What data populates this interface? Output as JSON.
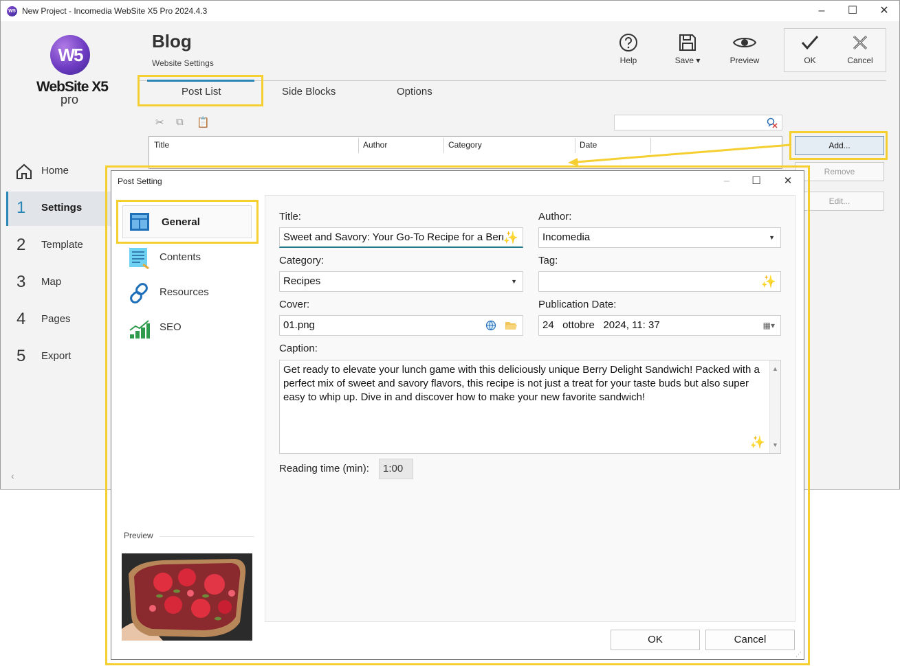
{
  "window": {
    "title": "New Project - Incomedia WebSite X5 Pro 2024.4.3",
    "app_icon": "W5"
  },
  "logo": {
    "mark": "W5",
    "name": "WebSite X5",
    "edition": "pro"
  },
  "header": {
    "title": "Blog",
    "subtitle": "Website Settings"
  },
  "toolbar": {
    "help": "Help",
    "save": "Save ▾",
    "preview": "Preview",
    "ok": "OK",
    "cancel": "Cancel"
  },
  "tabs": [
    {
      "label": "Post List",
      "active": true
    },
    {
      "label": "Side Blocks"
    },
    {
      "label": "Options"
    }
  ],
  "post_table": {
    "columns": [
      "Title",
      "Author",
      "Category",
      "Date"
    ]
  },
  "side_buttons": {
    "add": "Add...",
    "remove": "Remove",
    "edit": "Edit..."
  },
  "nav": [
    {
      "num": "",
      "label": "Home",
      "icon": "home-icon"
    },
    {
      "num": "1",
      "label": "Settings",
      "active": true
    },
    {
      "num": "2",
      "label": "Template"
    },
    {
      "num": "3",
      "label": "Map"
    },
    {
      "num": "4",
      "label": "Pages"
    },
    {
      "num": "5",
      "label": "Export"
    }
  ],
  "dialog": {
    "title": "Post Setting",
    "nav": [
      {
        "label": "General",
        "icon": "layout-icon",
        "active": true
      },
      {
        "label": "Contents",
        "icon": "document-icon"
      },
      {
        "label": "Resources",
        "icon": "link-icon"
      },
      {
        "label": "SEO",
        "icon": "growth-chart-icon"
      }
    ],
    "preview_label": "Preview",
    "fields": {
      "title_label": "Title:",
      "title_value": "Sweet and Savory: Your Go-To Recipe for a Berry",
      "author_label": "Author:",
      "author_value": "Incomedia",
      "category_label": "Category:",
      "category_value": "Recipes",
      "tag_label": "Tag:",
      "tag_value": "",
      "cover_label": "Cover:",
      "cover_value": "01.png",
      "pubdate_label": "Publication Date:",
      "pubdate_value": "24   ottobre   2024, 11: 37",
      "caption_label": "Caption:",
      "caption_value": "Get ready to elevate your lunch game with this deliciously unique Berry Delight Sandwich! Packed with a perfect mix of sweet and savory flavors, this recipe is not just a treat for your taste buds but also super easy to whip up. Dive in and discover how to make your new favorite sandwich!",
      "reading_label": "Reading time (min):",
      "reading_value": "1:00"
    },
    "ok": "OK",
    "cancel": "Cancel"
  },
  "colors": {
    "accent": "#2a86b7",
    "highlight": "#f5cf30",
    "brand": "#6e3cc2"
  }
}
